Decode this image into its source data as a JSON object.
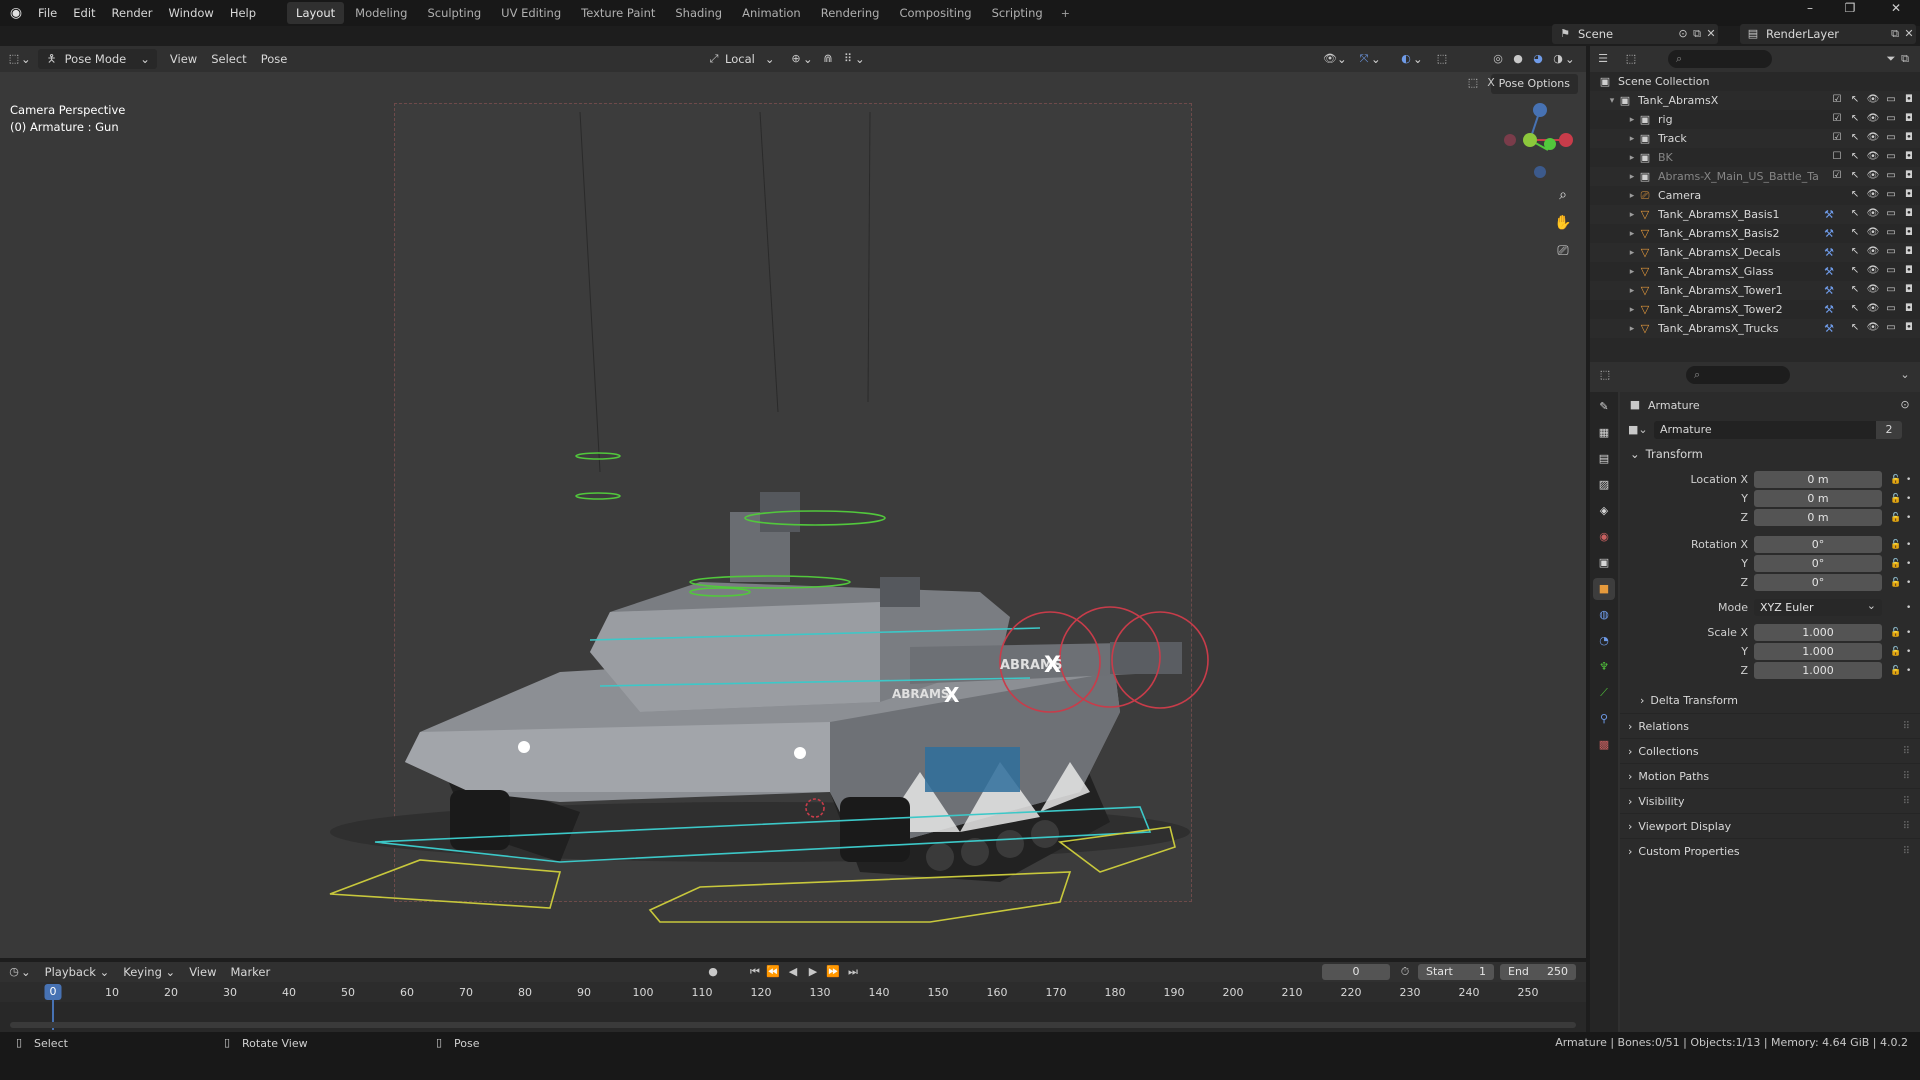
{
  "menu": {
    "items": [
      "File",
      "Edit",
      "Render",
      "Window",
      "Help"
    ]
  },
  "workspaces": [
    "Layout",
    "Modeling",
    "Sculpting",
    "UV Editing",
    "Texture Paint",
    "Shading",
    "Animation",
    "Rendering",
    "Compositing",
    "Scripting"
  ],
  "scene": {
    "name": "Scene",
    "view_layer": "RenderLayer"
  },
  "viewport_header": {
    "mode": "Pose Mode",
    "menus": [
      "View",
      "Select",
      "Pose"
    ],
    "orientation": "Local",
    "pose_options": "Pose Options"
  },
  "viewport": {
    "info_line1": "Camera Perspective",
    "info_line2": "(0) Armature : Gun",
    "barrel_text": "ABRAMS",
    "hull_text": "ABRAMS",
    "logo_x": "X"
  },
  "outliner": {
    "root": "Scene Collection",
    "collection": "Tank_AbramsX",
    "items": [
      {
        "label": "rig",
        "icon": "collection-icon",
        "dim": false
      },
      {
        "label": "Track",
        "icon": "collection-icon",
        "dim": false
      },
      {
        "label": "BK",
        "icon": "collection-icon",
        "dim": true
      },
      {
        "label": "Abrams-X_Main_US_Battle_Tan",
        "icon": "collection-icon",
        "dim": true
      },
      {
        "label": "Camera",
        "icon": "camera-icon",
        "dim": false
      },
      {
        "label": "Tank_AbramsX_Basis1",
        "icon": "mesh-icon",
        "dim": false
      },
      {
        "label": "Tank_AbramsX_Basis2",
        "icon": "mesh-icon",
        "dim": false
      },
      {
        "label": "Tank_AbramsX_Decals",
        "icon": "mesh-icon",
        "dim": false
      },
      {
        "label": "Tank_AbramsX_Glass",
        "icon": "mesh-icon",
        "dim": false
      },
      {
        "label": "Tank_AbramsX_Tower1",
        "icon": "mesh-icon",
        "dim": false
      },
      {
        "label": "Tank_AbramsX_Tower2",
        "icon": "mesh-icon",
        "dim": false
      },
      {
        "label": "Tank_AbramsX_Trucks",
        "icon": "mesh-icon",
        "dim": false
      }
    ]
  },
  "properties": {
    "object_name": "Armature",
    "data_name": "Armature",
    "users": "2",
    "transform_title": "Transform",
    "location_x_label": "Location X",
    "y_label": "Y",
    "z_label": "Z",
    "rotation_x_label": "Rotation X",
    "mode_label": "Mode",
    "scale_x_label": "Scale X",
    "location": [
      "0 m",
      "0 m",
      "0 m"
    ],
    "rotation": [
      "0°",
      "0°",
      "0°"
    ],
    "rotation_mode": "XYZ Euler",
    "scale": [
      "1.000",
      "1.000",
      "1.000"
    ],
    "delta": "Delta Transform",
    "panels": [
      "Relations",
      "Collections",
      "Motion Paths",
      "Visibility",
      "Viewport Display",
      "Custom Properties"
    ]
  },
  "timeline": {
    "menus": [
      "Playback",
      "Keying",
      "View",
      "Marker"
    ],
    "current_frame": "0",
    "start_label": "Start",
    "start": "1",
    "end_label": "End",
    "end": "250",
    "ticks": [
      "0",
      "10",
      "20",
      "30",
      "40",
      "50",
      "60",
      "70",
      "80",
      "90",
      "100",
      "110",
      "120",
      "130",
      "140",
      "150",
      "160",
      "170",
      "180",
      "190",
      "200",
      "210",
      "220",
      "230",
      "240",
      "250"
    ]
  },
  "statusbar": {
    "select": "Select",
    "rotate": "Rotate View",
    "pose": "Pose",
    "stats": "Armature | Bones:0/51 | Objects:1/13 | Memory: 4.64 GiB | 4.0.2"
  },
  "colors": {
    "accent": "#4772b3",
    "bone_green": "#52c83c",
    "bone_cyan": "#3cc8c8",
    "bone_yellow": "#c8c83c",
    "bone_red": "#c83c4a"
  }
}
